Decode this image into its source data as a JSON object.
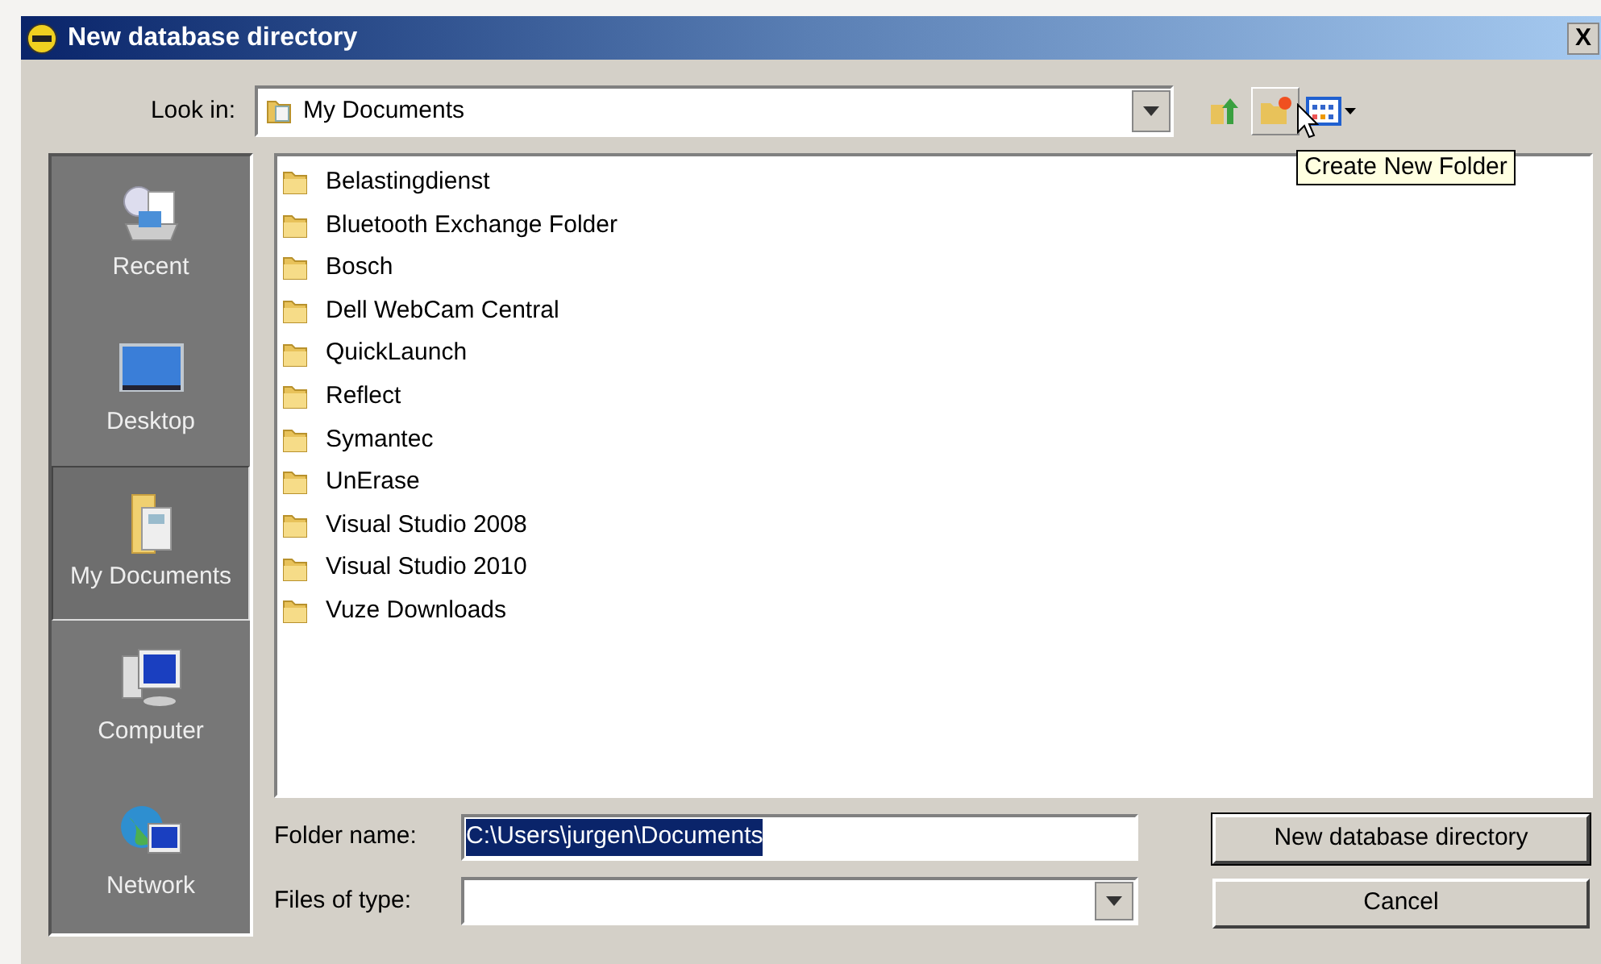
{
  "window": {
    "title": "New database directory",
    "close": "X"
  },
  "look_in": {
    "label": "Look in:",
    "value": "My Documents"
  },
  "toolbar": {
    "tooltip": "Create New Folder"
  },
  "places": [
    {
      "label": "Recent",
      "kind": "recent",
      "selected": false
    },
    {
      "label": "Desktop",
      "kind": "desktop",
      "selected": false
    },
    {
      "label": "My Documents",
      "kind": "documents",
      "selected": true
    },
    {
      "label": "Computer",
      "kind": "computer",
      "selected": false
    },
    {
      "label": "Network",
      "kind": "network",
      "selected": false
    }
  ],
  "files": [
    "Belastingdienst",
    "Bluetooth Exchange Folder",
    "Bosch",
    "Dell WebCam Central",
    "QuickLaunch",
    "Reflect",
    "Symantec",
    "UnErase",
    "Visual Studio 2008",
    "Visual Studio 2010",
    "Vuze Downloads"
  ],
  "folder_name": {
    "label": "Folder name:",
    "value": "C:\\Users\\jurgen\\Documents"
  },
  "files_of_type": {
    "label": "Files of type:"
  },
  "buttons": [
    "New database directory",
    "Cancel"
  ]
}
